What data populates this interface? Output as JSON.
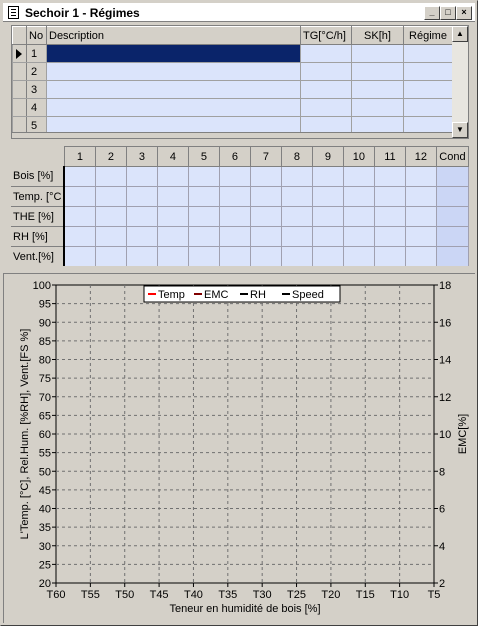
{
  "window": {
    "title": "Sechoir 1 - Régimes",
    "controls": {
      "minimize": "_",
      "maximize": "□",
      "close": "×"
    }
  },
  "regimes_grid": {
    "columns": [
      "No",
      "Description",
      "TG[°C/h]",
      "SK[h]",
      "Régime"
    ],
    "rows": [
      {
        "no": "1",
        "description": "",
        "tg": "",
        "sk": "",
        "regime": ""
      },
      {
        "no": "2",
        "description": "",
        "tg": "",
        "sk": "",
        "regime": ""
      },
      {
        "no": "3",
        "description": "",
        "tg": "",
        "sk": "",
        "regime": ""
      },
      {
        "no": "4",
        "description": "",
        "tg": "",
        "sk": "",
        "regime": ""
      },
      {
        "no": "5",
        "description": "",
        "tg": "",
        "sk": "",
        "regime": ""
      }
    ],
    "scroll_up": "▲",
    "scroll_down": "▼"
  },
  "steps_grid": {
    "columns": [
      "1",
      "2",
      "3",
      "4",
      "5",
      "6",
      "7",
      "8",
      "9",
      "10",
      "11",
      "12",
      "Cond"
    ],
    "rows": [
      "Bois [%]",
      "Temp. [°C",
      "THE [%]",
      "RH [%]",
      "Vent.[%]"
    ]
  },
  "chart_data": {
    "type": "line",
    "title": "",
    "xlabel": "Teneur en humidité de bois [%]",
    "ylabel": "L'Temp. [°C], Rel.Hum. [%RH], Vent.[FS %]",
    "y2label": "EMC[%]",
    "categories": [
      "T60",
      "T55",
      "T50",
      "T45",
      "T40",
      "T35",
      "T30",
      "T25",
      "T20",
      "T15",
      "T10",
      "T5"
    ],
    "ylim": [
      20,
      100
    ],
    "yticks": [
      "100",
      "95",
      "90",
      "85",
      "80",
      "75",
      "70",
      "65",
      "60",
      "55",
      "50",
      "45",
      "40",
      "35",
      "30",
      "25",
      "20"
    ],
    "y2lim": [
      2,
      18
    ],
    "y2ticks": [
      "18",
      "16",
      "14",
      "12",
      "10",
      "8",
      "6",
      "4",
      "2"
    ],
    "grid": true,
    "legend_position": "top-center",
    "series": [
      {
        "name": "Temp",
        "color": "#ff0000",
        "values": []
      },
      {
        "name": "EMC",
        "color": "#800000",
        "values": []
      },
      {
        "name": "RH",
        "color": "#000000",
        "values": []
      },
      {
        "name": "Speed",
        "color": "#000000",
        "values": []
      }
    ]
  }
}
